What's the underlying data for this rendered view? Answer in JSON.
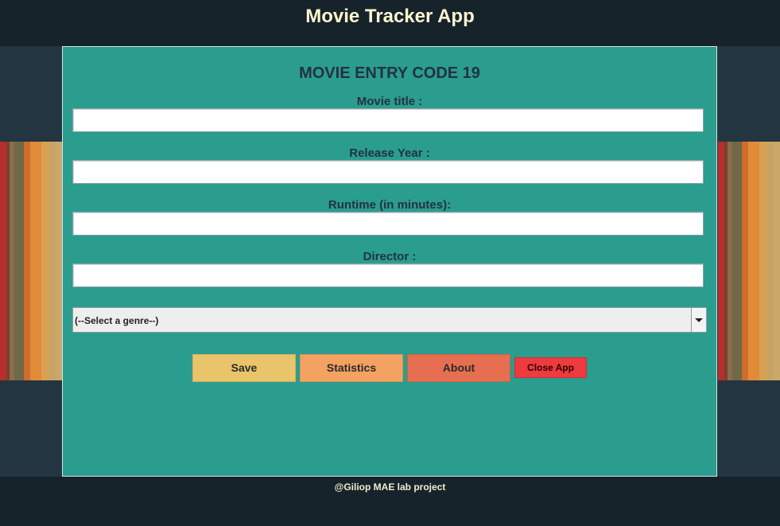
{
  "app": {
    "title": "Movie Tracker App"
  },
  "form": {
    "heading": "MOVIE ENTRY CODE 19",
    "fields": [
      {
        "label": "Movie title :",
        "value": "",
        "placeholder": ""
      },
      {
        "label": "Release Year :",
        "value": "",
        "placeholder": ""
      },
      {
        "label": "Runtime (in minutes):",
        "value": "",
        "placeholder": ""
      },
      {
        "label": "Director :",
        "value": "",
        "placeholder": ""
      }
    ],
    "genre": {
      "selected": "(--Select a genre--)"
    }
  },
  "buttons": {
    "save": "Save",
    "statistics": "Statistics",
    "about": "About",
    "close": "Close App"
  },
  "footer": {
    "text": "@Giliop MAE lab project"
  },
  "colors": {
    "header_bg": "#16232b",
    "panel_bg": "#2a9d8f",
    "save": "#e9c46a",
    "statistics": "#f4a261",
    "about": "#e76f51",
    "close": "#ef3a3f"
  },
  "icons": {
    "genre_dropdown": "chevron-down-icon"
  }
}
